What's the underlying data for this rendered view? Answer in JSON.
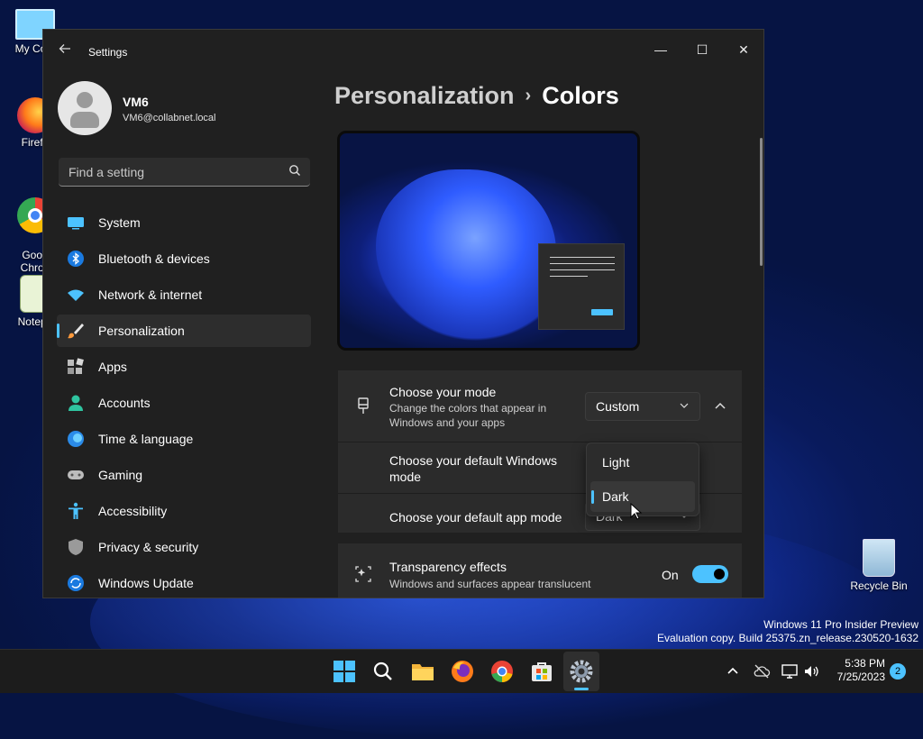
{
  "desktop": {
    "icons": [
      {
        "label": "My Com",
        "icon": "computer-icon"
      },
      {
        "label": "Firefo",
        "icon": "firefox-icon"
      },
      {
        "label": "Goog\nChron",
        "icon": "chrome-icon"
      },
      {
        "label": "Notepa",
        "icon": "notepad-icon"
      }
    ],
    "recycle_bin": {
      "label": "Recycle Bin",
      "icon": "recycle-bin-icon"
    },
    "watermark": {
      "line1": "Windows 11 Pro Insider Preview",
      "line2": "Evaluation copy. Build 25375.zn_release.230520-1632"
    }
  },
  "window": {
    "title": "Settings",
    "controls": {
      "minimize": "—",
      "maximize": "☐",
      "close": "✕"
    }
  },
  "sidebar": {
    "user": {
      "name": "VM6",
      "email": "VM6@collabnet.local"
    },
    "search": {
      "placeholder": "Find a setting"
    },
    "items": [
      {
        "label": "System",
        "icon": "system-icon"
      },
      {
        "label": "Bluetooth & devices",
        "icon": "bluetooth-icon"
      },
      {
        "label": "Network & internet",
        "icon": "network-icon"
      },
      {
        "label": "Personalization",
        "icon": "brush-icon",
        "active": true
      },
      {
        "label": "Apps",
        "icon": "apps-icon"
      },
      {
        "label": "Accounts",
        "icon": "accounts-icon"
      },
      {
        "label": "Time & language",
        "icon": "globe-icon"
      },
      {
        "label": "Gaming",
        "icon": "gamepad-icon"
      },
      {
        "label": "Accessibility",
        "icon": "accessibility-icon"
      },
      {
        "label": "Privacy & security",
        "icon": "shield-icon"
      },
      {
        "label": "Windows Update",
        "icon": "update-icon"
      }
    ]
  },
  "main": {
    "breadcrumb": {
      "parent": "Personalization",
      "separator": "›",
      "current": "Colors"
    },
    "mode": {
      "title": "Choose your mode",
      "description": "Change the colors that appear in Windows and your apps",
      "value": "Custom",
      "expanded": true
    },
    "dropdown": {
      "options": [
        "Light",
        "Dark"
      ],
      "selected": "Dark"
    },
    "default_windows_mode": {
      "title": "Choose your default Windows mode"
    },
    "default_app_mode": {
      "title": "Choose your default app mode",
      "value": "Dark"
    },
    "transparency": {
      "title": "Transparency effects",
      "description": "Windows and surfaces appear translucent",
      "state_label": "On",
      "on": true
    }
  },
  "taskbar": {
    "apps": [
      "start-icon",
      "search-icon",
      "file-explorer-icon",
      "firefox-icon",
      "chrome-icon",
      "store-icon",
      "settings-icon"
    ],
    "active_app": "settings-icon",
    "time": "5:38 PM",
    "date": "7/25/2023",
    "notification_count": "2"
  },
  "colors": {
    "accent": "#4cc2ff",
    "window_bg": "#202020",
    "card_bg": "#2b2b2b"
  }
}
